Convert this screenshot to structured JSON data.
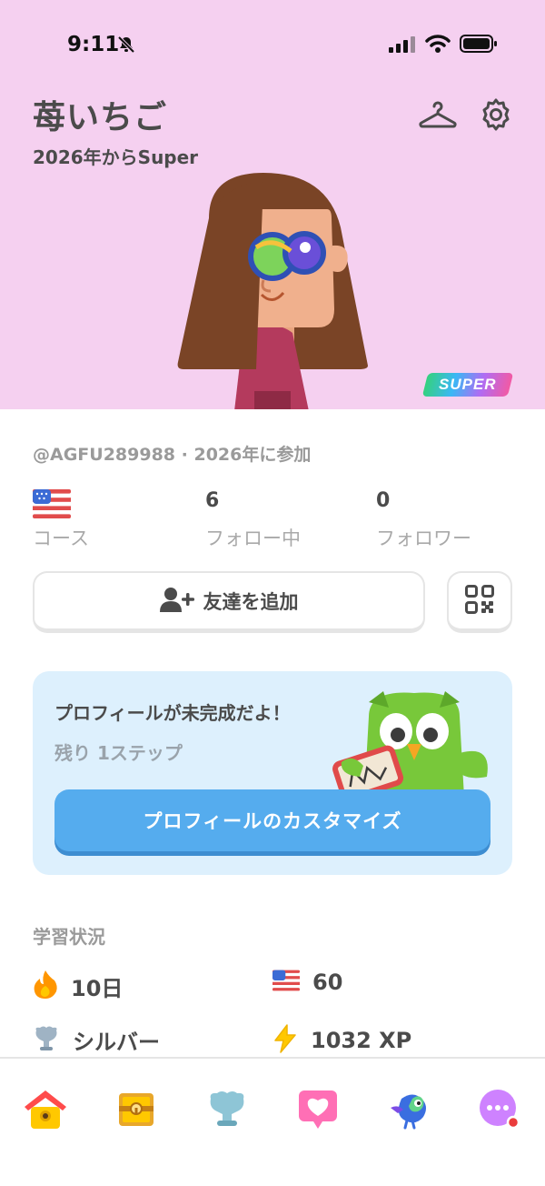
{
  "status_bar": {
    "time": "9:11"
  },
  "profile": {
    "name": "苺いちご",
    "super_since": "2026年からSuper",
    "super_badge": "SUPER",
    "handle_line": "@AGFU289988 · 2026年に参加"
  },
  "stats": {
    "course_label": "コース",
    "following_value": "6",
    "following_label": "フォロー中",
    "followers_value": "0",
    "followers_label": "フォロワー"
  },
  "actions": {
    "add_friend_label": "友達を追加"
  },
  "promo": {
    "title": "プロフィールが未完成だよ！",
    "subtitle": "残り 1ステップ",
    "cta_label": "プロフィールのカスタマイズ"
  },
  "learning": {
    "header": "学習状況",
    "streak": "10日",
    "course_xp": "60",
    "league": "シルバー",
    "total_xp": "1032 XP"
  },
  "colors": {
    "hero_bg": "#f5d0f0",
    "primary_button": "#55acee",
    "promo_bg": "#ddf0fd",
    "notification_dot": "#ea3c3c"
  },
  "icons": {
    "header": [
      "hanger-icon",
      "gear-icon"
    ],
    "tabs": [
      "home-icon",
      "treasure-chest-icon",
      "league-trophy-icon",
      "heart-icon",
      "bird-icon",
      "more-icon"
    ]
  }
}
